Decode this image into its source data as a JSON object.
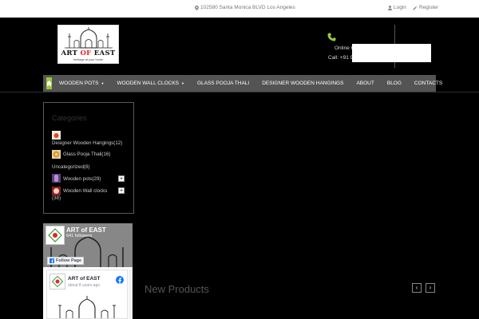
{
  "topbar": {
    "address": "102580 Santa Monica BLVD Los Angeles",
    "login": "Login",
    "register": "Register"
  },
  "logo": {
    "name_a": "ART ",
    "name_of": "OF",
    "name_b": " EAST",
    "tagline": "heritage at your home"
  },
  "contact": {
    "online": "Online C",
    "call": "Call: +91 9"
  },
  "nav": {
    "items": [
      {
        "label": "WOODEN POTS",
        "dropdown": true
      },
      {
        "label": "WOODEN WALL CLOCKS",
        "dropdown": true
      },
      {
        "label": "GLASS POOJA THALI"
      },
      {
        "label": "DESIGNER WOODEN HANGINGS"
      },
      {
        "label": "ABOUT"
      },
      {
        "label": "BLOG"
      },
      {
        "label": "CONTACTS"
      }
    ]
  },
  "categories": {
    "title": "Categories",
    "items": [
      {
        "label": "Designer Wooden Hangings",
        "count": "(12)"
      },
      {
        "label": "Glass Pooja Thali",
        "count": "(16)"
      },
      {
        "label": "Uncategorized",
        "count": "(8)"
      },
      {
        "label": "Wooden pots",
        "count": "(29)"
      },
      {
        "label": "Wooden Wall clocks",
        "count": "(38)"
      }
    ],
    "expand_symbol": "+"
  },
  "facebook": {
    "page_name": "ART of EAST",
    "followers": "641 followers",
    "follow_label": "Follow Page",
    "post_name": "ART of EAST",
    "post_time": "about 8 years ago"
  },
  "new_products": {
    "title": "New Products",
    "prev": "‹",
    "next": "›"
  },
  "colors": {
    "accent": "#9ac83b",
    "nav_bg": "#545454",
    "facebook_blue": "#1877f2",
    "logo_red": "#e4232b"
  }
}
